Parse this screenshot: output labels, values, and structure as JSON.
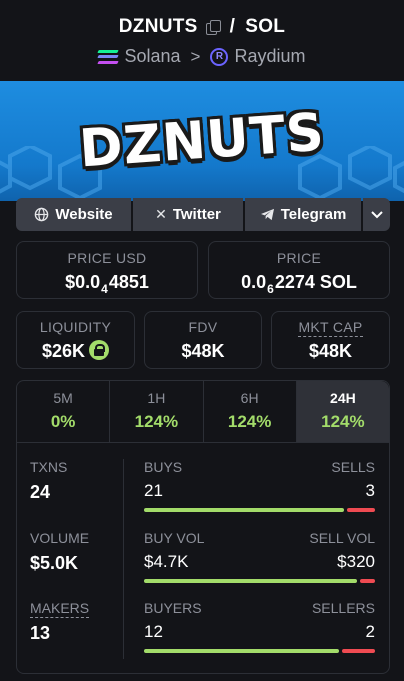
{
  "header": {
    "token_symbol": "DZNUTS",
    "separator": "/",
    "quote_symbol": "SOL",
    "chain": "Solana",
    "chevron": ">",
    "dex": "Raydium",
    "dex_icon_letter": "R",
    "icons": {
      "copy": "copy-icon",
      "chain": "solana-logo",
      "dex": "raydium-logo"
    }
  },
  "banner": {
    "logo_text": "DZNUTS"
  },
  "links": {
    "website": "Website",
    "twitter": "Twitter",
    "telegram": "Telegram",
    "icons": {
      "website": "globe-icon",
      "twitter": "x-icon",
      "telegram": "telegram-icon",
      "more": "chevron-down-icon"
    }
  },
  "price_usd": {
    "label": "PRICE USD",
    "prefix": "$0.0",
    "zeros": "4",
    "digits": "4851"
  },
  "price_sol": {
    "label": "PRICE",
    "prefix": "0.0",
    "zeros": "6",
    "digits": "2274 SOL"
  },
  "liquidity": {
    "label": "LIQUIDITY",
    "value": "$26K"
  },
  "fdv": {
    "label": "FDV",
    "value": "$48K"
  },
  "mkt_cap": {
    "label": "MKT CAP",
    "value": "$48K"
  },
  "timeframes": [
    {
      "label": "5M",
      "value": "0%"
    },
    {
      "label": "1H",
      "value": "124%"
    },
    {
      "label": "6H",
      "value": "124%"
    },
    {
      "label": "24H",
      "value": "124%",
      "active": true
    }
  ],
  "stats": {
    "txns": {
      "label": "TXNS",
      "value": "24"
    },
    "volume": {
      "label": "VOLUME",
      "value": "$5.0K"
    },
    "makers": {
      "label": "MAKERS",
      "value": "13"
    },
    "buys_sells": {
      "left_label": "BUYS",
      "right_label": "SELLS",
      "left_value": "21",
      "right_value": "3",
      "left_share": 0.875
    },
    "buy_sell_vol": {
      "left_label": "BUY VOL",
      "right_label": "SELL VOL",
      "left_value": "$4.7K",
      "right_value": "$320",
      "left_share": 0.936
    },
    "buyers_sellers": {
      "left_label": "BUYERS",
      "right_label": "SELLERS",
      "left_value": "12",
      "right_value": "2",
      "left_share": 0.857
    }
  },
  "colors": {
    "positive": "#a3dc6a",
    "negative": "#ef4b52",
    "banner": "#1479cc",
    "background": "#131418"
  }
}
